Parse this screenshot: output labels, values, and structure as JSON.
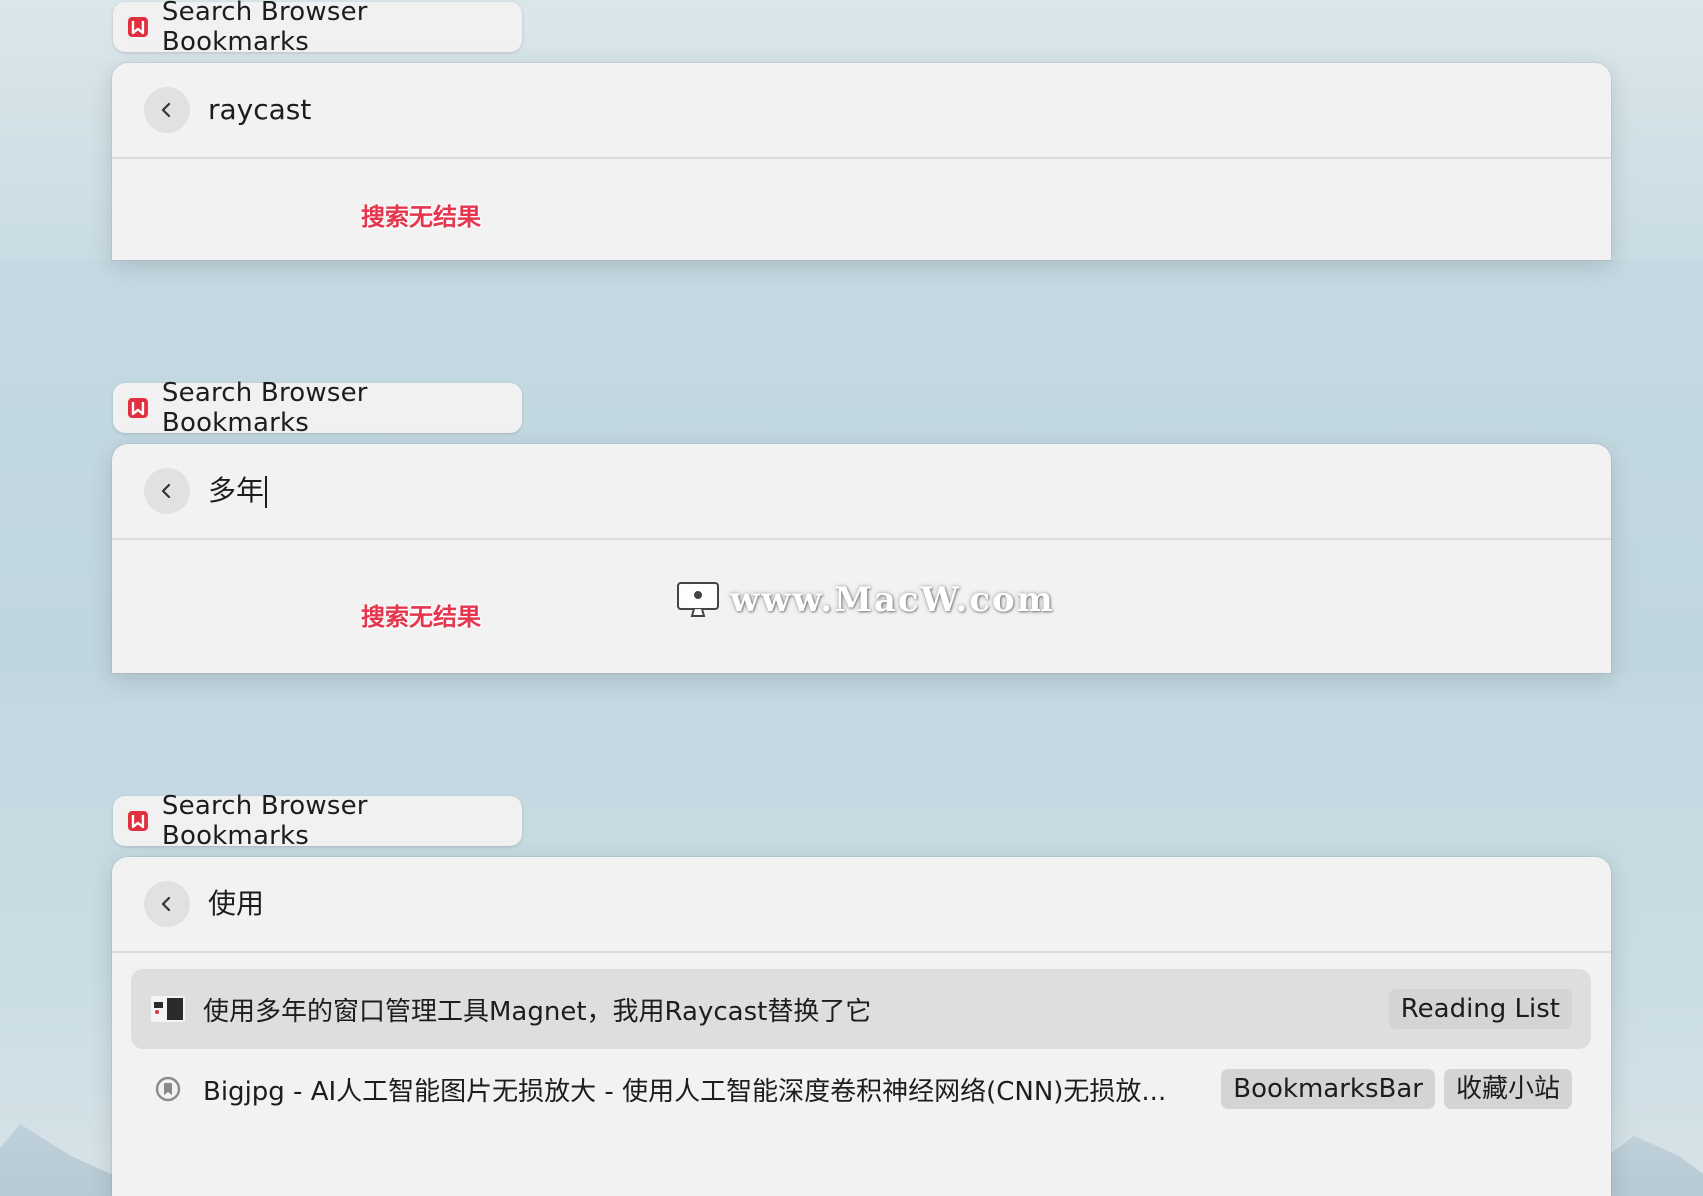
{
  "app": {
    "title": "Search Browser Bookmarks",
    "accent_color": "#e0303f",
    "icon": "bookmark-app-icon"
  },
  "frames": [
    {
      "query": "raycast",
      "no_results": "搜索无结果"
    },
    {
      "query": "多年",
      "no_results": "搜索无结果"
    },
    {
      "query": "使用",
      "results": [
        {
          "title": "使用多年的窗口管理工具Magnet，我用Raycast替换了它",
          "tags": [
            "Reading List"
          ],
          "icon": "site-favicon"
        },
        {
          "title": "Bigjpg - AI人工智能图片无损放大 - 使用人工智能深度卷积神经网络(CNN)无损放...",
          "tags": [
            "BookmarksBar",
            "收藏小站"
          ],
          "icon": "generic-bookmark-icon"
        }
      ]
    }
  ],
  "watermark": {
    "text": "www.MacW.com"
  }
}
